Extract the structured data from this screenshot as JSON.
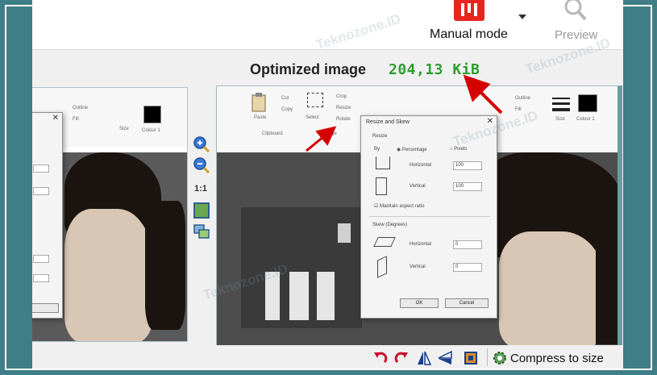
{
  "toolbar": {
    "mode_label": "Manual mode",
    "mode_icon": "manual-mode-icon",
    "preview_label": "Preview",
    "preview_icon": "magnifier-icon"
  },
  "optimized": {
    "header": "Optimized image",
    "size": "204,13 KiB",
    "size_color": "#2e9d2e"
  },
  "zoom": {
    "fit_label": "1:1"
  },
  "dialog": {
    "title": "Resize and Skew",
    "resize_label": "Resize",
    "by_label": "By",
    "percentage_label": "Percentage",
    "pixels_label": "Pixels",
    "horizontal_label": "Horizontal",
    "horizontal_value": "100",
    "vertical_label": "Vertical",
    "vertical_value": "100",
    "aspect_label": "Maintain aspect ratio",
    "skew_label": "Skew (Degrees)",
    "skew_horizontal_label": "Horizontal",
    "skew_horizontal_value": "0",
    "skew_vertical_label": "Vertical",
    "skew_vertical_value": "0",
    "ok_label": "OK",
    "cancel_label": "Cancel"
  },
  "ribbon": {
    "paste_label": "Paste",
    "cut_label": "Cut",
    "copy_label": "Copy",
    "clipboard_label": "Clipboard",
    "select_label": "Select",
    "crop_label": "Crop",
    "resize_label": "Resize",
    "rotate_label": "Rotate",
    "image_label": "Image",
    "outline_label": "Outline",
    "fill_label": "Fill",
    "size_label": "Size",
    "colour_label": "Colour 1"
  },
  "bottom": {
    "compress_label": "Compress to size",
    "icons": [
      "rotate-left-icon",
      "rotate-right-icon",
      "flip-horizontal-icon",
      "flip-vertical-icon",
      "crop-icon",
      "gear-icon"
    ]
  },
  "watermark": "Teknozone.ID",
  "colors": {
    "background": "#3f7e86",
    "accent_red": "#e8251d",
    "size_green": "#2e9d2e"
  }
}
